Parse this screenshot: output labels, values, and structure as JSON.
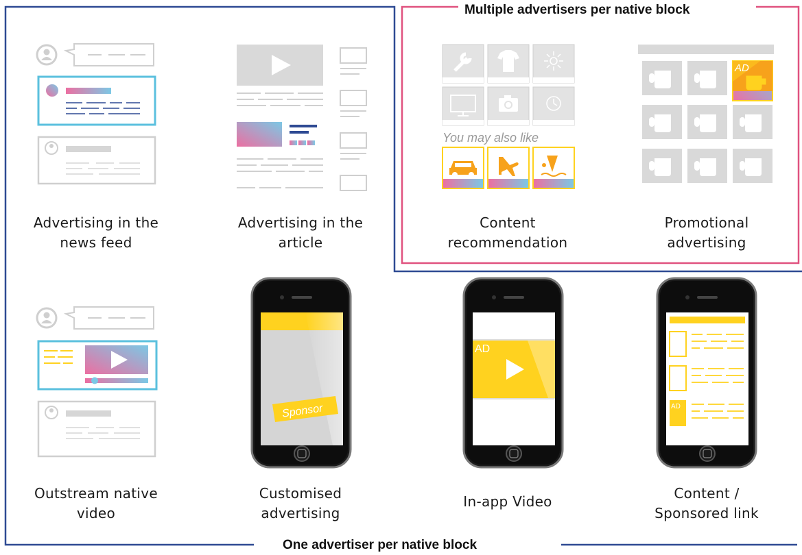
{
  "groups": {
    "multiple": "Multiple advertisers per native block",
    "single": "One advertiser per native block"
  },
  "labels": {
    "you_may_also_like": "You may also like",
    "ad": "AD",
    "sponsor": "Sponsor"
  },
  "formats": [
    {
      "line1": "Advertising in the",
      "line2": "news feed"
    },
    {
      "line1": "Advertising in the",
      "line2": "article"
    },
    {
      "line1": "Content",
      "line2": "recommendation"
    },
    {
      "line1": "Promotional",
      "line2": "advertising"
    },
    {
      "line1": "Outstream native",
      "line2": "video"
    },
    {
      "line1": "Customised",
      "line2": "advertising"
    },
    {
      "line1": "In-app Video",
      "line2": ""
    },
    {
      "line1": "Content /",
      "line2": "Sponsored link"
    }
  ],
  "colors": {
    "blue_frame": "#2e4a93",
    "pink_frame": "#e0527f",
    "accent_yellow": "#ffd21f",
    "gradient_pink": "#ec6fa1",
    "gradient_blue": "#7cc8e5"
  }
}
